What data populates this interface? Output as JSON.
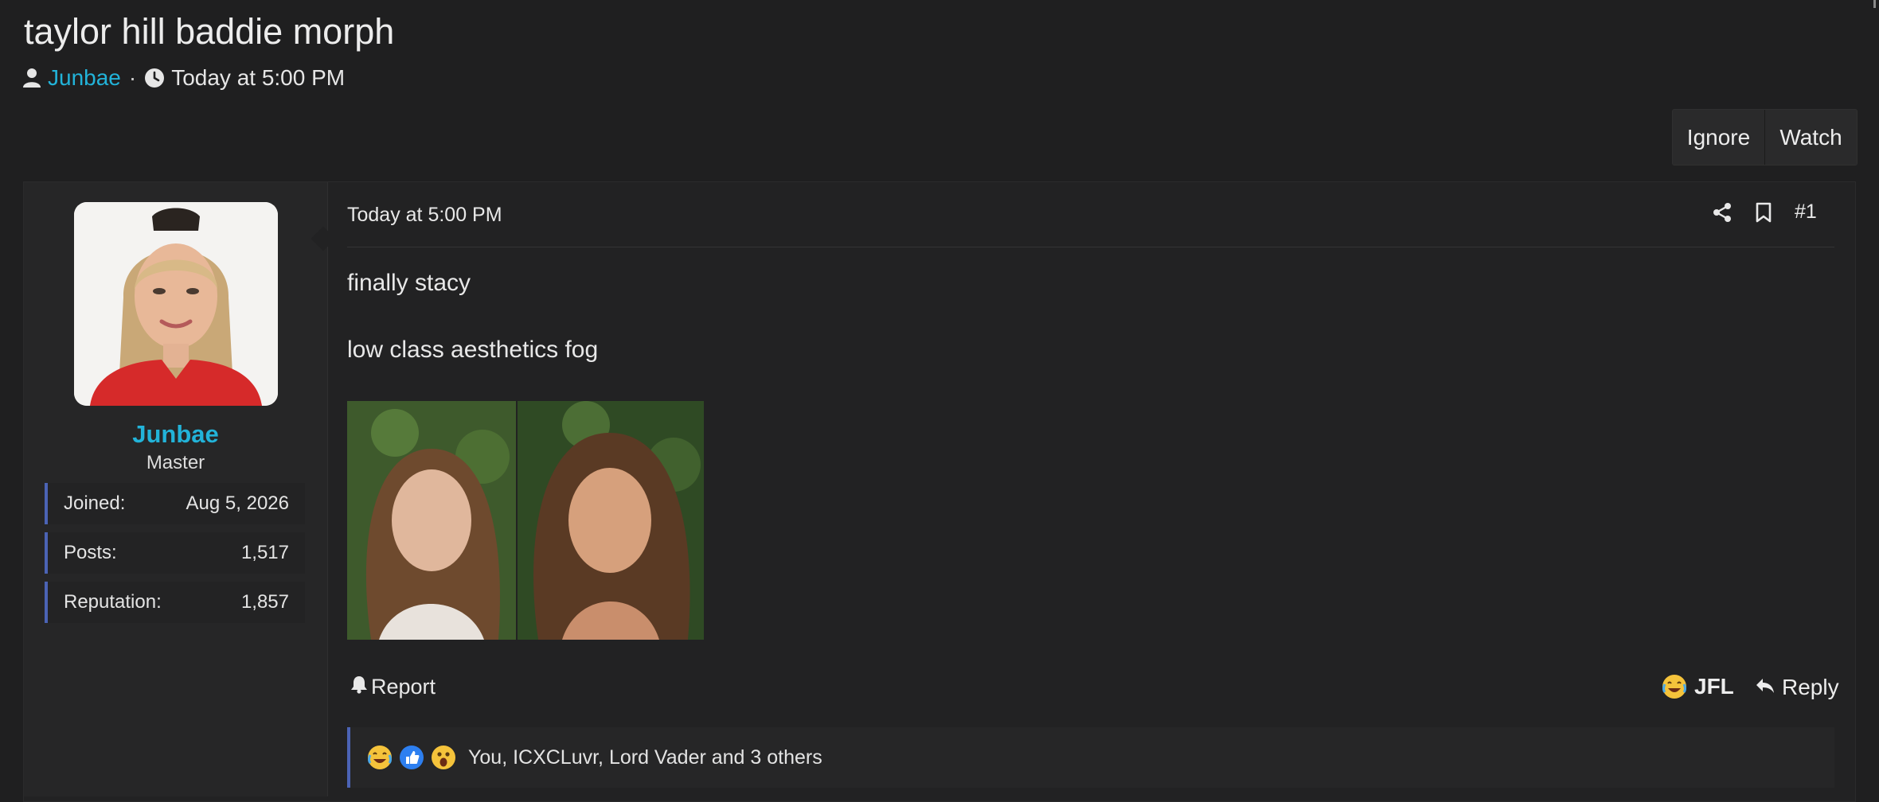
{
  "thread": {
    "title": "taylor hill baddie morph",
    "author": "Junbae",
    "separator": "·",
    "date": "Today at 5:00 PM"
  },
  "actions": {
    "ignore": "Ignore",
    "watch": "Watch"
  },
  "user": {
    "name": "Junbae",
    "title": "Master",
    "stats": [
      {
        "label": "Joined:",
        "value": "Aug 5, 2026"
      },
      {
        "label": "Posts:",
        "value": "1,517"
      },
      {
        "label": "Reputation:",
        "value": "1,857"
      }
    ]
  },
  "post": {
    "date": "Today at 5:00 PM",
    "number": "#1",
    "lines": [
      "finally stacy",
      "low class aesthetics fog"
    ],
    "report_label": "Report",
    "jfl_label": "JFL",
    "reply_label": "Reply",
    "reactions_text": "You, ICXCLuvr, Lord Vader and 3 others"
  },
  "icons": {
    "author": "user-icon",
    "time": "clock-icon",
    "share": "share-icon",
    "bookmark": "bookmark-icon",
    "report": "bell-icon",
    "jfl": "laughing-crying-emoji-icon",
    "reply": "reply-arrow-icon",
    "reactions": [
      "laughing-crying-emoji-icon",
      "thumbs-up-icon",
      "shocked-emoji-icon"
    ]
  },
  "colors": {
    "background": "#1f1f20",
    "accent": "#22b3d9",
    "stat_border": "#4b63b5"
  }
}
